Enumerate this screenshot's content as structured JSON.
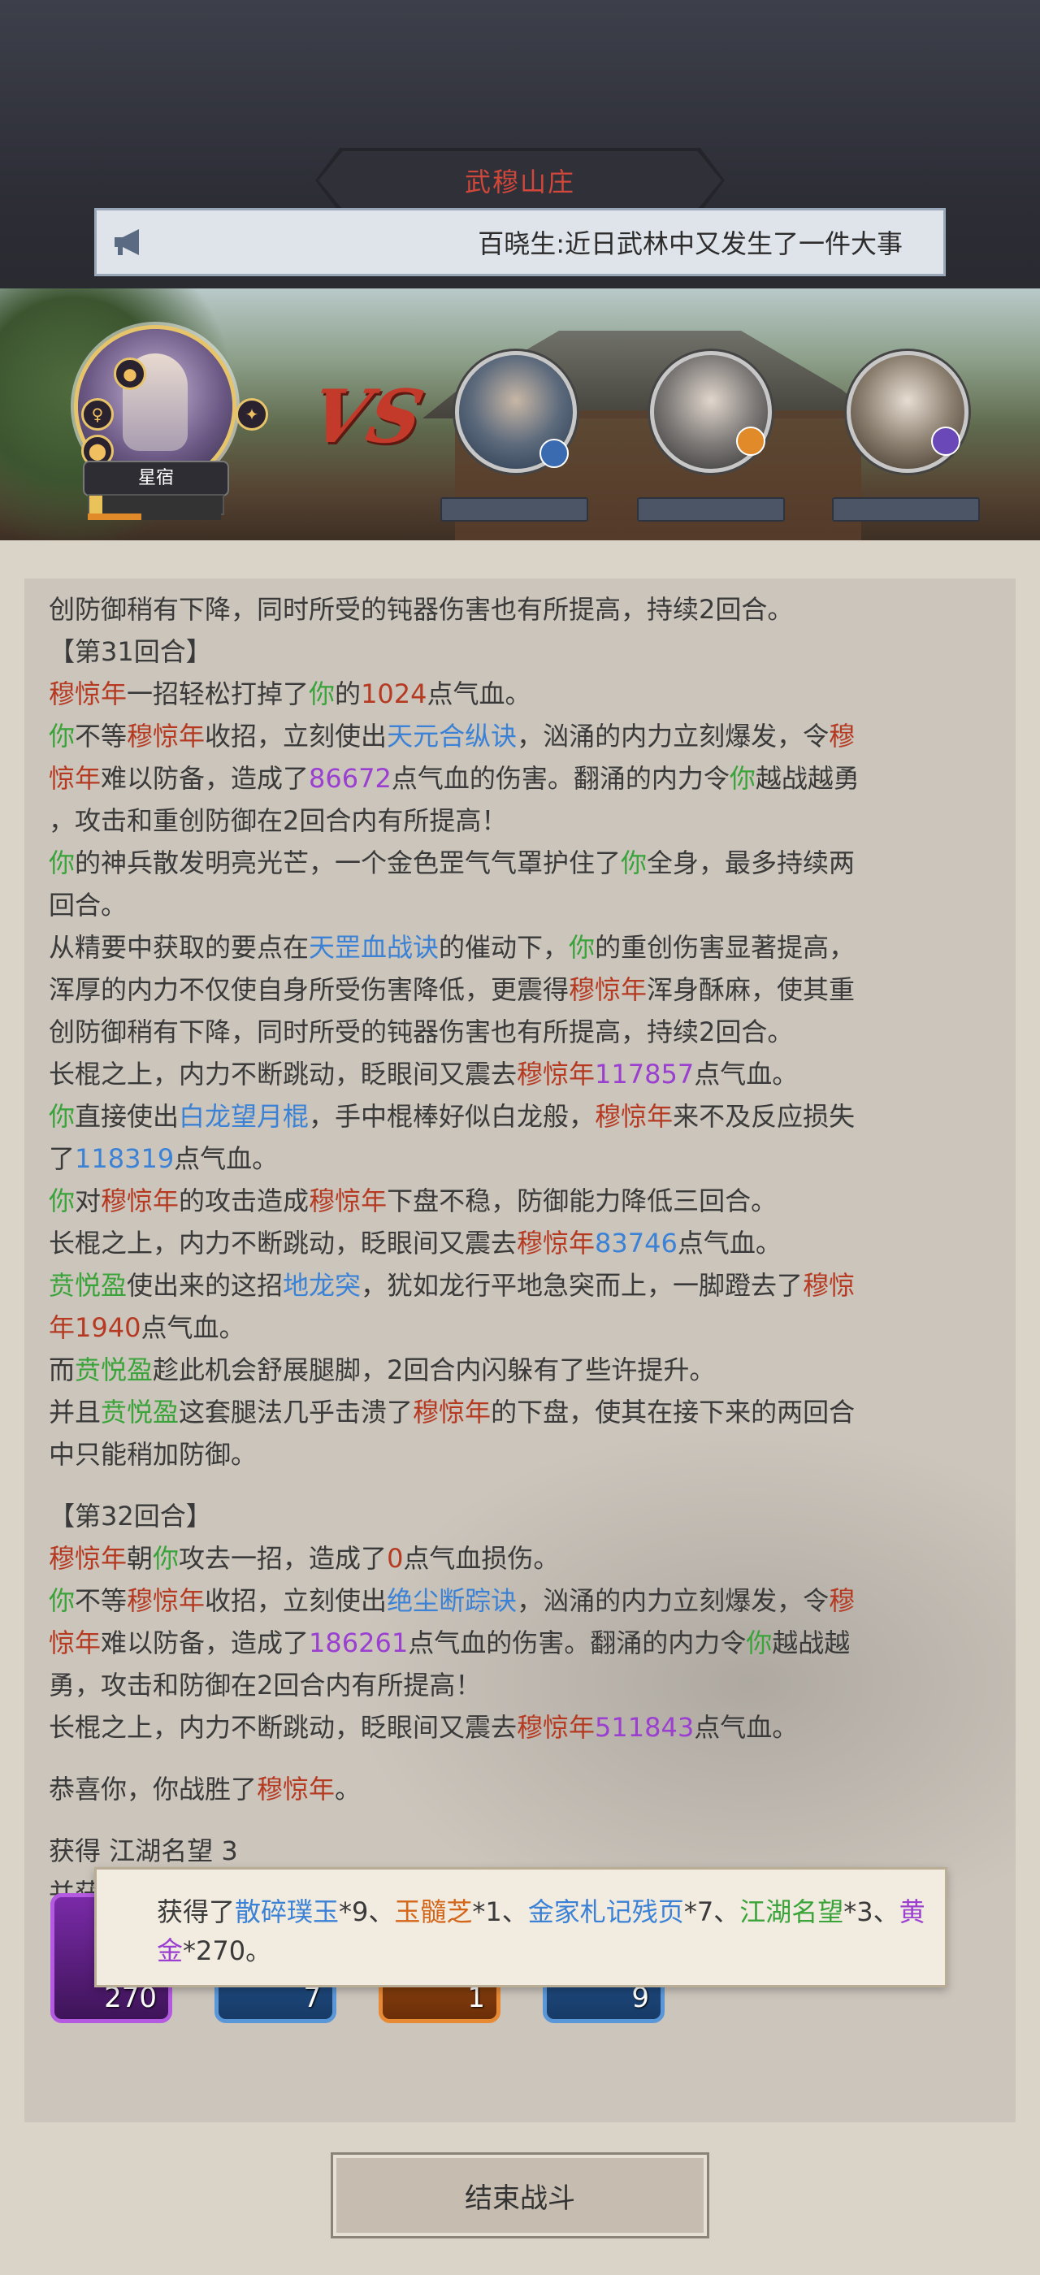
{
  "header": {
    "title": "武穆山庄",
    "notice": "百晓生:近日武林中又发生了一件大事"
  },
  "battle": {
    "hero_name": "星宿",
    "vs_label": "VS",
    "hero_hp_fraction": 0.1,
    "hero_energy_fraction": 0.4
  },
  "colors": {
    "enemy": "#b63a22",
    "self": "#3aa33a",
    "skill": "#3b82d6",
    "number_purple": "#9a3fd0",
    "item_orange": "#d4661a"
  },
  "log": [
    [
      {
        "t": "创防御稍有下降，同时所受的钝器伤害也有所提高，持续2回合。"
      }
    ],
    [
      {
        "t": "【第31回合】"
      }
    ],
    [
      {
        "t": "穆惊年",
        "c": "r"
      },
      {
        "t": "一招轻松打掉了"
      },
      {
        "t": "你",
        "c": "g"
      },
      {
        "t": "的"
      },
      {
        "t": "1024",
        "c": "r"
      },
      {
        "t": "点气血。"
      }
    ],
    [
      {
        "t": "你",
        "c": "g"
      },
      {
        "t": "不等"
      },
      {
        "t": "穆惊年",
        "c": "r"
      },
      {
        "t": "收招，立刻使出"
      },
      {
        "t": "天元合纵诀",
        "c": "b"
      },
      {
        "t": "，汹涌的内力立刻爆发，令"
      },
      {
        "t": "穆",
        "c": "r"
      }
    ],
    [
      {
        "t": "惊年",
        "c": "r"
      },
      {
        "t": "难以防备，造成了"
      },
      {
        "t": "86672",
        "c": "p"
      },
      {
        "t": "点气血的伤害。翻涌的内力令"
      },
      {
        "t": "你",
        "c": "g"
      },
      {
        "t": "越战越勇"
      }
    ],
    [
      {
        "t": "，攻击和重创防御在2回合内有所提高！"
      }
    ],
    [
      {
        "t": "你",
        "c": "g"
      },
      {
        "t": "的神兵散发明亮光芒，一个金色罡气气罩护住了"
      },
      {
        "t": "你",
        "c": "g"
      },
      {
        "t": "全身，最多持续两"
      }
    ],
    [
      {
        "t": "回合。"
      }
    ],
    [
      {
        "t": "从精要中获取的要点在"
      },
      {
        "t": "天罡血战诀",
        "c": "b"
      },
      {
        "t": "的催动下，"
      },
      {
        "t": "你",
        "c": "g"
      },
      {
        "t": "的重创伤害显著提高，"
      }
    ],
    [
      {
        "t": "浑厚的内力不仅使自身所受伤害降低，更震得"
      },
      {
        "t": "穆惊年",
        "c": "r"
      },
      {
        "t": "浑身酥麻，使其重"
      }
    ],
    [
      {
        "t": "创防御稍有下降，同时所受的钝器伤害也有所提高，持续2回合。"
      }
    ],
    [
      {
        "t": "长棍之上，内力不断跳动，眨眼间又震去"
      },
      {
        "t": "穆惊年",
        "c": "r"
      },
      {
        "t": "117857",
        "c": "p"
      },
      {
        "t": "点气血。"
      }
    ],
    [
      {
        "t": "你",
        "c": "g"
      },
      {
        "t": "直接使出"
      },
      {
        "t": "白龙望月棍",
        "c": "b"
      },
      {
        "t": "，手中棍棒好似白龙般，"
      },
      {
        "t": "穆惊年",
        "c": "r"
      },
      {
        "t": "来不及反应损失"
      }
    ],
    [
      {
        "t": "了"
      },
      {
        "t": "118319",
        "c": "b"
      },
      {
        "t": "点气血。"
      }
    ],
    [
      {
        "t": "你",
        "c": "g"
      },
      {
        "t": "对"
      },
      {
        "t": "穆惊年",
        "c": "r"
      },
      {
        "t": "的攻击造成"
      },
      {
        "t": "穆惊年",
        "c": "r"
      },
      {
        "t": "下盘不稳，防御能力降低三回合。"
      }
    ],
    [
      {
        "t": "长棍之上，内力不断跳动，眨眼间又震去"
      },
      {
        "t": "穆惊年",
        "c": "r"
      },
      {
        "t": "83746",
        "c": "b"
      },
      {
        "t": "点气血。"
      }
    ],
    [
      {
        "t": "贲悦盈",
        "c": "g"
      },
      {
        "t": "使出来的这招"
      },
      {
        "t": "地龙突",
        "c": "b"
      },
      {
        "t": "，犹如龙行平地急突而上，一脚蹬去了"
      },
      {
        "t": "穆惊",
        "c": "r"
      }
    ],
    [
      {
        "t": "年",
        "c": "r"
      },
      {
        "t": "1940",
        "c": "r"
      },
      {
        "t": "点气血。"
      }
    ],
    [
      {
        "t": "而"
      },
      {
        "t": "贲悦盈",
        "c": "g"
      },
      {
        "t": "趁此机会舒展腿脚，2回合内闪躲有了些许提升。"
      }
    ],
    [
      {
        "t": "并且"
      },
      {
        "t": "贲悦盈",
        "c": "g"
      },
      {
        "t": "这套腿法几乎击溃了"
      },
      {
        "t": "穆惊年",
        "c": "r"
      },
      {
        "t": "的下盘，使其在接下来的两回合"
      }
    ],
    [
      {
        "t": "中只能稍加防御。"
      }
    ],
    [],
    [
      {
        "t": "【第32回合】"
      }
    ],
    [
      {
        "t": "穆惊年",
        "c": "r"
      },
      {
        "t": "朝"
      },
      {
        "t": "你",
        "c": "g"
      },
      {
        "t": "攻去一招，造成了"
      },
      {
        "t": "0",
        "c": "r"
      },
      {
        "t": "点气血损伤。"
      }
    ],
    [
      {
        "t": "你",
        "c": "g"
      },
      {
        "t": "不等"
      },
      {
        "t": "穆惊年",
        "c": "r"
      },
      {
        "t": "收招，立刻使出"
      },
      {
        "t": "绝尘断踪诀",
        "c": "b"
      },
      {
        "t": "，汹涌的内力立刻爆发，令"
      },
      {
        "t": "穆",
        "c": "r"
      }
    ],
    [
      {
        "t": "惊年",
        "c": "r"
      },
      {
        "t": "难以防备，造成了"
      },
      {
        "t": "186261",
        "c": "p"
      },
      {
        "t": "点气血的伤害。翻涌的内力令"
      },
      {
        "t": "你",
        "c": "g"
      },
      {
        "t": "越战越"
      }
    ],
    [
      {
        "t": "勇，攻击和防御在2回合内有所提高！"
      }
    ],
    [
      {
        "t": "长棍之上，内力不断跳动，眨眼间又震去"
      },
      {
        "t": "穆惊年",
        "c": "r"
      },
      {
        "t": "511843",
        "c": "p"
      },
      {
        "t": "点气血。"
      }
    ],
    [],
    [
      {
        "t": "恭喜你，你战胜了"
      },
      {
        "t": "穆惊年",
        "c": "r"
      },
      {
        "t": "。"
      }
    ],
    [],
    [
      {
        "t": "获得 "
      },
      {
        "t": "江湖名望 3",
        "c": "w"
      }
    ],
    [
      {
        "t": "并获得以下奖励："
      }
    ]
  ],
  "reward_popup": [
    {
      "t": "获得了"
    },
    {
      "t": "散碎璞玉",
      "c": "b"
    },
    {
      "t": "*9、"
    },
    {
      "t": "玉髓芝",
      "c": "o"
    },
    {
      "t": "*1、"
    },
    {
      "t": "金家札记残页",
      "c": "b"
    },
    {
      "t": "*7、"
    },
    {
      "t": "江湖名望",
      "c": "g"
    },
    {
      "t": "*3、"
    },
    {
      "t": "黄金",
      "c": "p"
    },
    {
      "t": "*270。"
    }
  ],
  "reward_slots": [
    {
      "count": "270",
      "rarity": "purple"
    },
    {
      "count": "7",
      "rarity": "blue"
    },
    {
      "count": "1",
      "rarity": "orange"
    },
    {
      "count": "9",
      "rarity": "blue"
    }
  ],
  "end_button": "结束战斗"
}
